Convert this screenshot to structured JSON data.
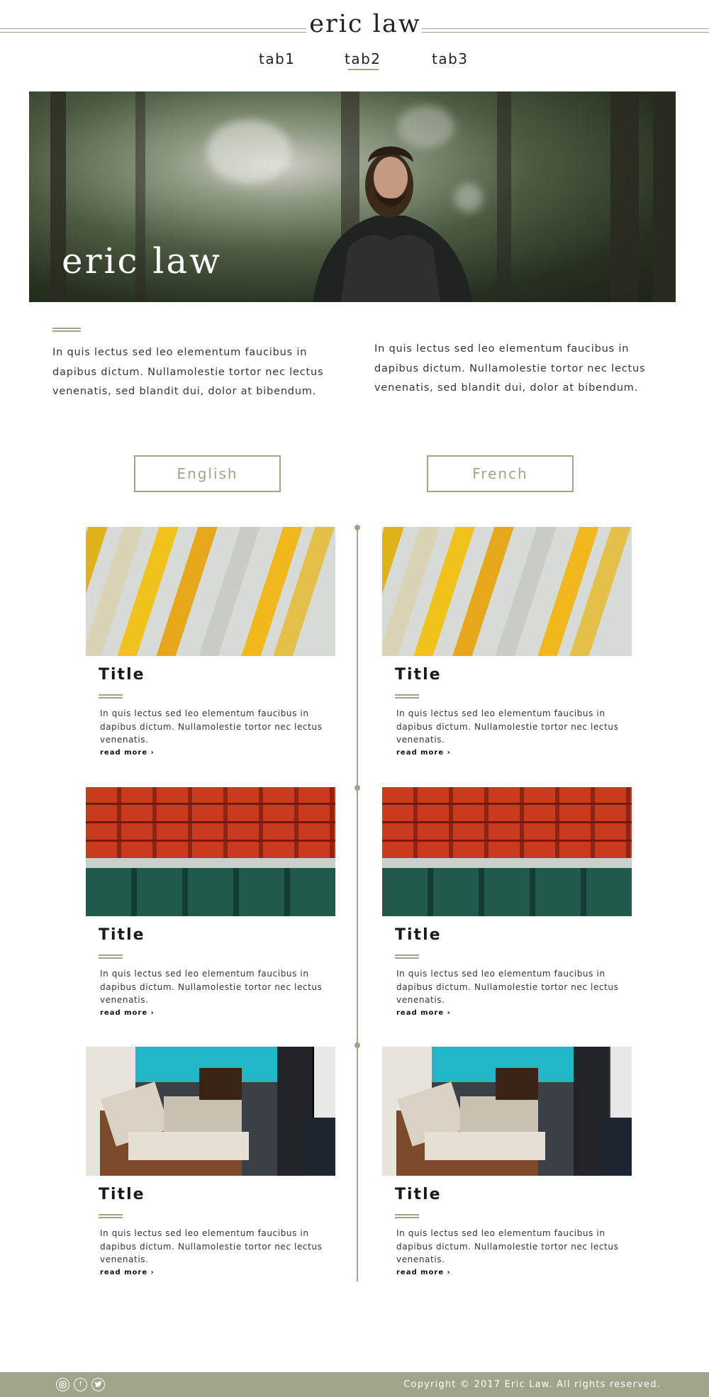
{
  "header": {
    "brand": "eric law",
    "tabs": [
      {
        "label": "tab1"
      },
      {
        "label": "tab2",
        "active": true
      },
      {
        "label": "tab3"
      }
    ]
  },
  "hero": {
    "title": "eric law"
  },
  "intro": {
    "left_text": "In quis lectus sed leo elementum faucibus in dapibus dictum. Nullamolestie tortor nec lectus venenatis, sed blandit dui, dolor at bibendum.",
    "right_text": "In quis lectus sed leo elementum faucibus in dapibus dictum. Nullamolestie tortor nec lectus venenatis, sed blandit dui, dolor at bibendum."
  },
  "language": {
    "english_label": "English",
    "french_label": "French"
  },
  "cards": {
    "english": [
      {
        "title": "Title",
        "text": "In quis lectus sed leo elementum faucibus in dapibus dictum. Nullamolestie tortor nec lectus venenatis.",
        "more": "read more ›",
        "image": "building-photo"
      },
      {
        "title": "Title",
        "text": "In quis lectus sed leo elementum faucibus in dapibus dictum. Nullamolestie tortor nec lectus venenatis.",
        "more": "read more ›",
        "image": "stadium-seats-photo"
      },
      {
        "title": "Title",
        "text": "In quis lectus sed leo elementum faucibus in dapibus dictum. Nullamolestie tortor nec lectus venenatis.",
        "more": "read more ›",
        "image": "record-store-photo"
      }
    ],
    "french": [
      {
        "title": "Title",
        "text": "In quis lectus sed leo elementum faucibus in dapibus dictum. Nullamolestie tortor nec lectus venenatis.",
        "more": "read more ›",
        "image": "building-photo"
      },
      {
        "title": "Title",
        "text": "In quis lectus sed leo elementum faucibus in dapibus dictum. Nullamolestie tortor nec lectus venenatis.",
        "more": "read more ›",
        "image": "stadium-seats-photo"
      },
      {
        "title": "Title",
        "text": "In quis lectus sed leo elementum faucibus in dapibus dictum. Nullamolestie tortor nec lectus venenatis.",
        "more": "read more ›",
        "image": "record-store-photo"
      }
    ]
  },
  "footer": {
    "social_icons": [
      "instagram-icon",
      "facebook-icon",
      "twitter-icon"
    ],
    "copyright": "Copyright © 2017 Eric Law. All rights reserved."
  },
  "colors": {
    "accent": "#a3a28a",
    "text": "#222222",
    "background": "#ffffff"
  }
}
